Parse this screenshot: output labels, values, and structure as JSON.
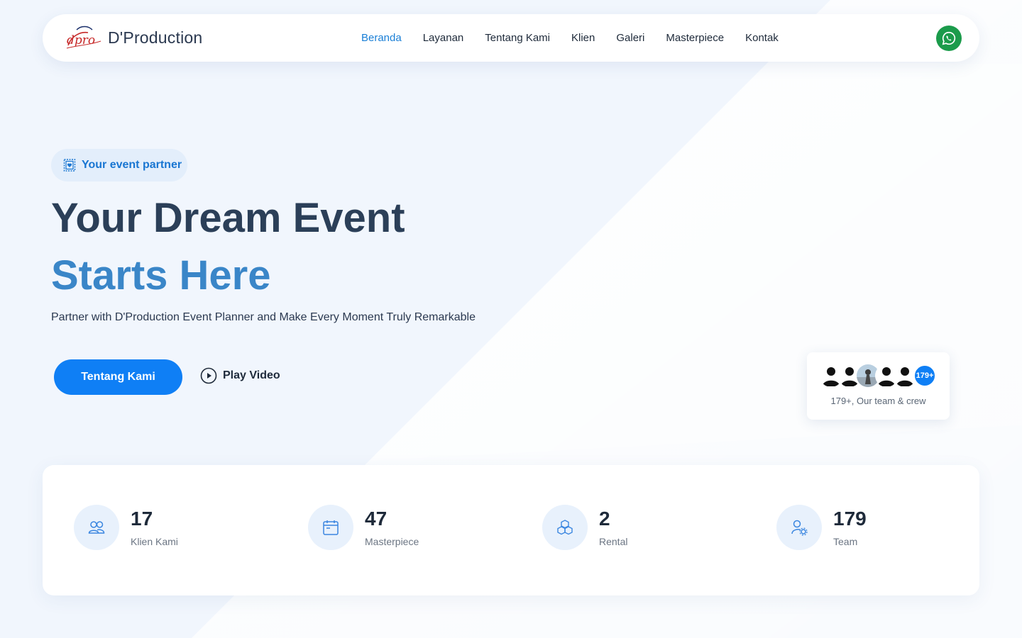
{
  "brand": {
    "name": "D'Production",
    "logo_text": "dpro"
  },
  "nav": {
    "items": [
      {
        "label": "Beranda",
        "active": true
      },
      {
        "label": "Layanan",
        "active": false
      },
      {
        "label": "Tentang Kami",
        "active": false
      },
      {
        "label": "Klien",
        "active": false
      },
      {
        "label": "Galeri",
        "active": false
      },
      {
        "label": "Masterpiece",
        "active": false
      },
      {
        "label": "Kontak",
        "active": false
      }
    ],
    "whatsapp_icon": "whatsapp-icon"
  },
  "hero": {
    "badge": "Your event partner",
    "title_line1": "Your Dream Event",
    "title_line2": "Starts Here",
    "subtitle": "Partner with D'Production Event Planner and Make Every Moment Truly Remarkable",
    "primary_button": "Tentang Kami",
    "play_video": "Play Video"
  },
  "team": {
    "count_badge": "179+",
    "caption": "179+, Our team & crew"
  },
  "stats": [
    {
      "value": "17",
      "label": "Klien Kami",
      "icon": "users-icon"
    },
    {
      "value": "47",
      "label": "Masterpiece",
      "icon": "calendar-icon"
    },
    {
      "value": "2",
      "label": "Rental",
      "icon": "boxes-icon"
    },
    {
      "value": "179",
      "label": "Team",
      "icon": "user-settings-icon"
    }
  ],
  "colors": {
    "accent": "#0f7ff5",
    "nav_active": "#1a7fd6",
    "title_dark": "#2b3f58",
    "title_blue": "#3a86c8",
    "whatsapp": "#1b9b4b",
    "background": "#f1f6fd"
  }
}
